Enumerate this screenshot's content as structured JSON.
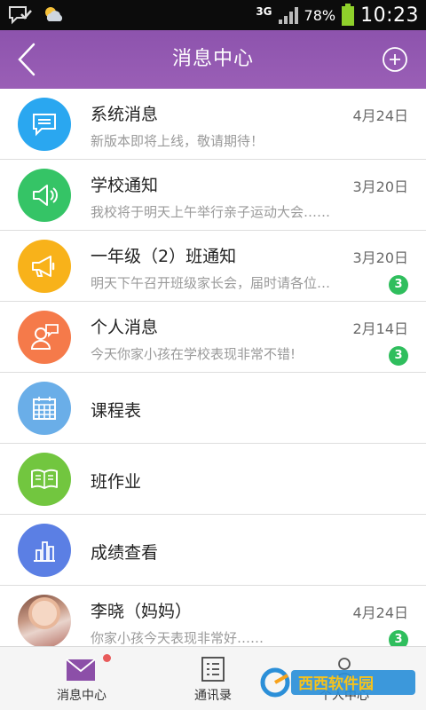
{
  "status_bar": {
    "network": "3G",
    "battery": "78%",
    "time": "10:23"
  },
  "header": {
    "title": "消息中心",
    "back_icon": "chevron-left-icon",
    "add_icon": "plus-circle-icon"
  },
  "rows": [
    {
      "title": "系统消息",
      "date": "4月24日",
      "preview": "新版本即将上线，敬请期待！",
      "icon": "chat-bubble-icon",
      "color": "#2aa7f0"
    },
    {
      "title": "学校通知",
      "date": "3月20日",
      "preview": "我校将于明天上午举行亲子运动大会……",
      "icon": "speaker-icon",
      "color": "#35c466"
    },
    {
      "title": "一年级（2）班通知",
      "date": "3月20日",
      "preview": "明天下午召开班级家长会，届时请各位…",
      "badge": "3",
      "icon": "megaphone-icon",
      "color": "#f8b21a"
    },
    {
      "title": "个人消息",
      "date": "2月14日",
      "preview": "今天你家小孩在学校表现非常不错!",
      "badge": "3",
      "icon": "person-message-icon",
      "color": "#f57a4a"
    },
    {
      "title": "课程表",
      "icon": "calendar-icon",
      "color": "#6aaee8"
    },
    {
      "title": "班作业",
      "icon": "book-icon",
      "color": "#72c63f"
    },
    {
      "title": "成绩查看",
      "icon": "bar-chart-icon",
      "color": "#5b7fe4"
    },
    {
      "title": "李晓（妈妈）",
      "date": "4月24日",
      "preview": "你家小孩今天表现非常好……",
      "badge": "3",
      "icon": "user-photo"
    }
  ],
  "tabs": [
    {
      "label": "消息中心",
      "icon": "envelope-icon",
      "active": true
    },
    {
      "label": "通讯录",
      "icon": "contacts-list-icon",
      "active": false
    },
    {
      "label": "个人中心",
      "icon": "person-icon",
      "active": false
    }
  ],
  "watermark": "西西软件园"
}
